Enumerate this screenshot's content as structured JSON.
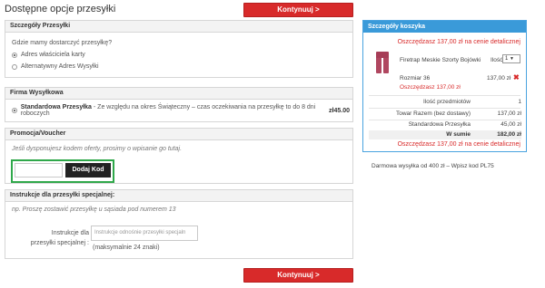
{
  "page": {
    "title": "Dostępne opcje przesyłki"
  },
  "buttons": {
    "continue_top": "Kontynuuj >",
    "continue_bottom": "Kontynuuj >"
  },
  "shipping_details": {
    "heading": "Szczegóły Przesyłki",
    "question": "Gdzie mamy dostarczyć przesyłkę?",
    "options": [
      {
        "label": "Adres właściciela karty",
        "selected": true
      },
      {
        "label": "Alternatywny Adres Wysyłki",
        "selected": false
      }
    ]
  },
  "shipping_company": {
    "heading": "Firma Wysyłkowa",
    "option_name": "Standardowa Przesyłka",
    "option_desc": " - Ze względu na okres Świąteczny – czas oczekiwania na przesyłkę to do 8 dni roboczych",
    "price": "zł45.00",
    "selected": true
  },
  "promo": {
    "heading": "Promocja/Voucher",
    "hint": "Jeśli dysponujesz kodem oferty, prosimy o wpisanie go tutaj.",
    "input_value": "",
    "button": "Dodaj Kod"
  },
  "instructions": {
    "heading": "Instrukcje dla przesyłki specjalnej:",
    "hint": "np. Proszę zostawić przesyłkę u sąsiada pod numerem 13",
    "label": "Instrukcje dla przesyłki specjalnej :",
    "placeholder": "Instrukcje odnośnie przesyłki specjaln",
    "max_note": "(maksymalnie 24 znaki)"
  },
  "cart": {
    "heading": "Szczegóły koszyka",
    "saving_top": "Oszczędzasz 137,00 zł na cenie detalicznej",
    "product_name": "Firetrap Meskie Szorty Bojówki",
    "qty_label": "Ilość",
    "qty_value": "1",
    "size": "Rozmiar 36",
    "line_price": "137,00 zł",
    "saving_item": "Oszczędzasz 137,00 zł",
    "summary": [
      {
        "label": "Ilość przedmiotów",
        "value": "1"
      },
      {
        "label": "Towar Razem (bez dostawy)",
        "value": "137,00 zł"
      },
      {
        "label": "Standardowa Przesyłka",
        "value": "45,00 zł"
      }
    ],
    "total_label": "W sumie",
    "total_value": "182,00 zł",
    "saving_bottom": "Oszczędzasz 137,00 zł na cenie detalicznej",
    "colors": {
      "accent": "#3a9ad9",
      "saving": "#d82a2a"
    }
  },
  "free_shipping_note": "Darmowa wysyłka od 400 zł – Wpisz kod PL75",
  "icons": {
    "remove": "close-icon",
    "radio": "radio-icon"
  }
}
